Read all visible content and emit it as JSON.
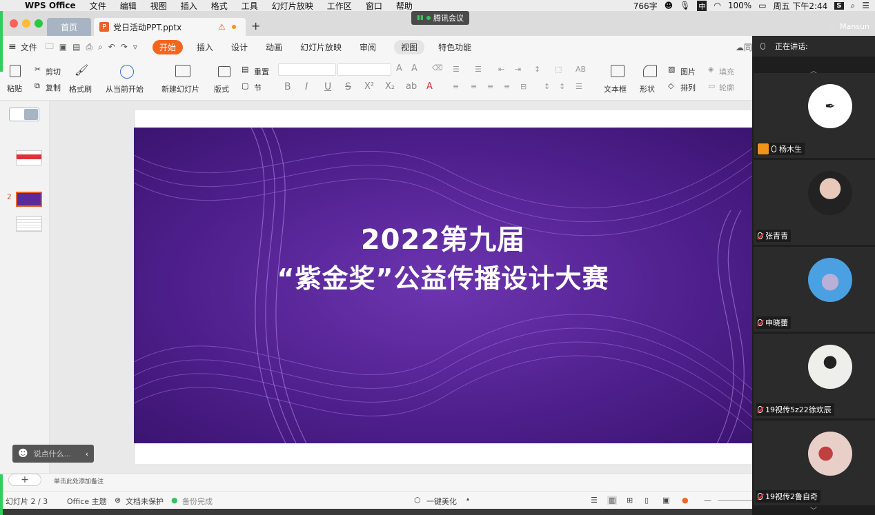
{
  "menubar": {
    "app": "WPS Office",
    "items": [
      "文件",
      "编辑",
      "视图",
      "插入",
      "格式",
      "工具",
      "幻灯片放映",
      "工作区",
      "窗口",
      "帮助"
    ],
    "right_wordcount": "766字",
    "input_method": "中",
    "battery": "100%",
    "datetime": "周五 下午2:44"
  },
  "meeting_pill": {
    "label": "腾讯会议"
  },
  "tabs": {
    "home": "首页",
    "doc": "党日活动PPT.pptx",
    "plus": "+"
  },
  "user": {
    "name": "Mansun"
  },
  "ribbon": {
    "menu": "文件",
    "tabs": [
      "开始",
      "插入",
      "设计",
      "动画",
      "幻灯片放映",
      "审阅",
      "视图",
      "特色功能"
    ],
    "sync_label": "同",
    "tools": {
      "paste": "粘贴",
      "cut": "剪切",
      "copy": "复制",
      "format_painter": "格式刷",
      "from_current": "从当前开始",
      "new_slide": "新建幻灯片",
      "layout": "版式",
      "reset": "重置",
      "section": "节",
      "textbox": "文本框",
      "shape": "形状",
      "picture": "图片",
      "fill": "填充",
      "arrange": "排列",
      "outline": "轮廓"
    }
  },
  "slides_pane": {
    "current_num": "2"
  },
  "slide": {
    "line1": "2022第九届",
    "line2": "“紫金奖”公益传播设计大赛"
  },
  "chat": {
    "placeholder": "说点什么..."
  },
  "notes": {
    "placeholder": "单击此处添加备注"
  },
  "status": {
    "slide_count": "幻灯片 2 / 3",
    "theme": "Office 主题",
    "protect": "文档未保护",
    "backup": "备份完成",
    "beautify": "一键美化"
  },
  "meeting": {
    "speaking_label": "正在讲话:",
    "participants": [
      {
        "name": "杨木生",
        "host": true,
        "mic": "on"
      },
      {
        "name": "张青青",
        "host": false,
        "mic": "off"
      },
      {
        "name": "申晓蕾",
        "host": false,
        "mic": "off"
      },
      {
        "name": "19视传5z22徐欢辰",
        "host": false,
        "mic": "off"
      },
      {
        "name": "19视传2鲁自奇",
        "host": false,
        "mic": "off"
      }
    ]
  },
  "colors": {
    "accent": "#f2661f",
    "slide_purple": "#5b2a9a",
    "meeting_green": "#2fcf5d"
  }
}
